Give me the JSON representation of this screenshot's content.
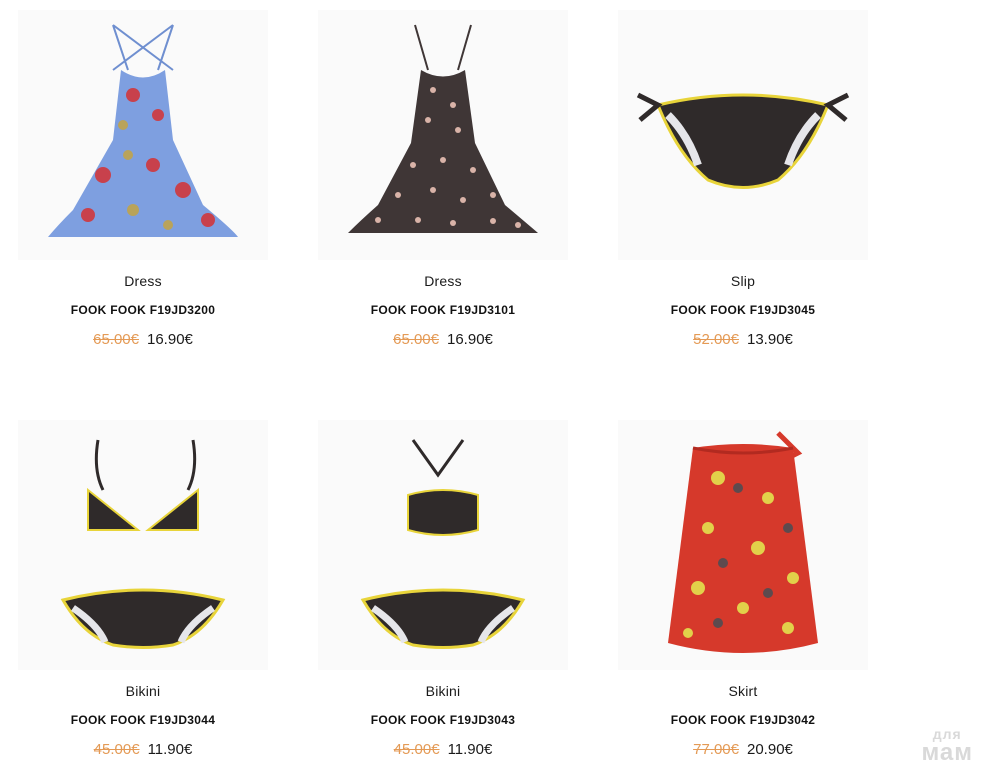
{
  "products": [
    {
      "category": "Dress",
      "title": "FOOK FOOK F19JD3200",
      "old_price": "65.00€",
      "new_price": "16.90€",
      "image_icon": "blue-floral-dress-image",
      "colors": {
        "base": "#7e9fe0",
        "accent": "#c8414c",
        "leaf": "#b9a35a"
      }
    },
    {
      "category": "Dress",
      "title": "FOOK FOOK F19JD3101",
      "old_price": "65.00€",
      "new_price": "16.90€",
      "image_icon": "brown-pattern-dress-image",
      "colors": {
        "base": "#3f3636",
        "accent": "#d9b3a8",
        "leaf": "#8c6d62"
      }
    },
    {
      "category": "Slip",
      "title": "FOOK FOOK F19JD3045",
      "old_price": "52.00€",
      "new_price": "13.90€",
      "image_icon": "bikini-bottom-image",
      "colors": {
        "base": "#2f2a2a",
        "accent": "#e8d43a",
        "leaf": "#e6e6ea"
      }
    },
    {
      "category": "Bikini",
      "title": "FOOK FOOK F19JD3044",
      "old_price": "45.00€",
      "new_price": "11.90€",
      "image_icon": "triangle-bikini-image",
      "colors": {
        "base": "#2f2a2a",
        "accent": "#e8d43a",
        "leaf": "#e6e6ea"
      }
    },
    {
      "category": "Bikini",
      "title": "FOOK FOOK F19JD3043",
      "old_price": "45.00€",
      "new_price": "11.90€",
      "image_icon": "bandeau-bikini-image",
      "colors": {
        "base": "#2f2a2a",
        "accent": "#e8d43a",
        "leaf": "#e6e6ea"
      }
    },
    {
      "category": "Skirt",
      "title": "FOOK FOOK F19JD3042",
      "old_price": "77.00€",
      "new_price": "20.90€",
      "image_icon": "red-floral-skirt-image",
      "colors": {
        "base": "#d6392b",
        "accent": "#e2d14a",
        "leaf": "#5d4a4e"
      }
    }
  ],
  "watermark": {
    "top": "для",
    "bottom": "мам"
  }
}
